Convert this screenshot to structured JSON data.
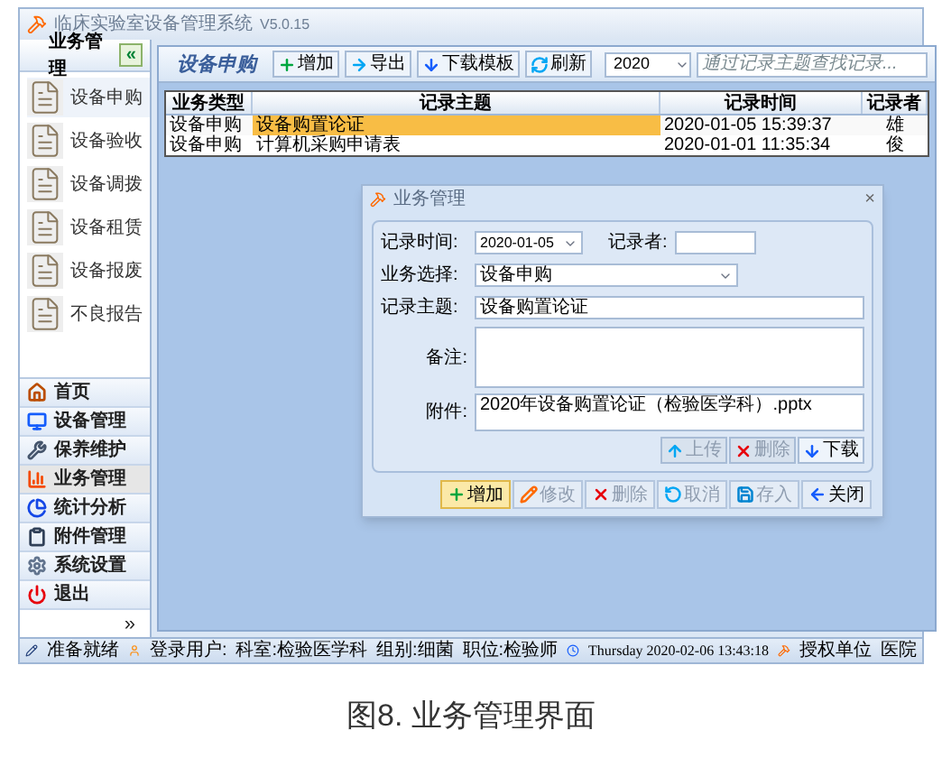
{
  "window": {
    "title": "临床实验室设备管理系统",
    "version": "V5.0.15"
  },
  "sidebar": {
    "header": "业务管理",
    "collapse_label": "«",
    "items": [
      {
        "label": "设备申购",
        "selected": true
      },
      {
        "label": "设备验收",
        "selected": false
      },
      {
        "label": "设备调拨",
        "selected": false
      },
      {
        "label": "设备租赁",
        "selected": false
      },
      {
        "label": "设备报废",
        "selected": false
      },
      {
        "label": "不良报告",
        "selected": false
      }
    ],
    "nav": [
      {
        "label": "首页",
        "selected": false
      },
      {
        "label": "设备管理",
        "selected": false
      },
      {
        "label": "保养维护",
        "selected": false
      },
      {
        "label": "业务管理",
        "selected": true
      },
      {
        "label": "统计分析",
        "selected": false
      },
      {
        "label": "附件管理",
        "selected": false
      },
      {
        "label": "系统设置",
        "selected": false
      },
      {
        "label": "退出",
        "selected": false
      }
    ],
    "more_label": "»"
  },
  "toolbar": {
    "title": "设备申购",
    "buttons": [
      "增加",
      "导出",
      "下载模板",
      "刷新"
    ],
    "year": "2020",
    "search": {
      "placeholder": "通过记录主题查找记录..."
    }
  },
  "table": {
    "columns": [
      "业务类型",
      "记录主题",
      "记录时间",
      "记录者"
    ],
    "rows": [
      {
        "cells": [
          "设备申购",
          "设备购置论证",
          "2020-01-05 15:39:37",
          "雄"
        ],
        "selected": true
      },
      {
        "cells": [
          "设备申购",
          "计算机采购申请表",
          "2020-01-01 11:35:34",
          "俊"
        ],
        "selected": false
      }
    ]
  },
  "dialog": {
    "title": "业务管理",
    "close": "×",
    "record_time": {
      "label": "记录时间:",
      "value": "2020-01-05"
    },
    "recorder": {
      "label": "记录者:"
    },
    "business": {
      "label": "业务选择:",
      "value": "设备申购"
    },
    "subject": {
      "label": "记录主题:",
      "value": "设备购置论证"
    },
    "note": {
      "label": "备注:"
    },
    "attachment": {
      "label": "附件:",
      "value": "2020年设备购置论证（检验医学科）.pptx"
    },
    "file_buttons": [
      {
        "label": "上传",
        "disabled": true
      },
      {
        "label": "删除",
        "disabled": true
      },
      {
        "label": "下载",
        "disabled": false
      }
    ],
    "buttons": [
      {
        "label": "增加",
        "disabled": false,
        "focused": true
      },
      {
        "label": "修改",
        "disabled": true,
        "focused": false
      },
      {
        "label": "删除",
        "disabled": true,
        "focused": false
      },
      {
        "label": "取消",
        "disabled": true,
        "focused": false
      },
      {
        "label": "存入",
        "disabled": true,
        "focused": false
      },
      {
        "label": "关闭",
        "disabled": false,
        "focused": false
      }
    ]
  },
  "status_bar": {
    "ready": "准备就绪",
    "user": "登录用户:",
    "department": "科室:检验医学科",
    "group": "组别:细菌",
    "position": "职位:检验师",
    "datetime": "Thursday 2020-02-06 13:43:18",
    "license": "授权单位",
    "license_org": "医院"
  },
  "caption": "图8. 业务管理界面"
}
